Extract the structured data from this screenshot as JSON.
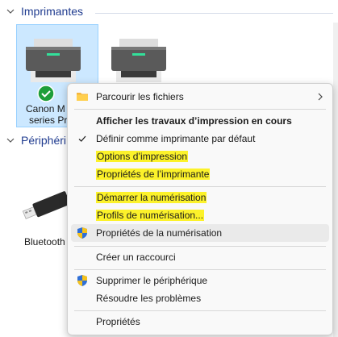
{
  "sections": [
    {
      "title": "Imprimantes"
    },
    {
      "title": "Périphéri"
    }
  ],
  "devices": [
    {
      "label_line1": "Canon M",
      "label_line2": "series Pr"
    },
    {
      "label": "Bluetooth"
    }
  ],
  "menu": {
    "items": [
      {
        "label": "Parcourir les fichiers"
      },
      {
        "label": "Afficher les travaux d’impression en cours"
      },
      {
        "label": "Définir comme imprimante par défaut"
      },
      {
        "label": "Options d’impression"
      },
      {
        "label": "Propriétés de l’imprimante"
      },
      {
        "label": "Démarrer la numérisation"
      },
      {
        "label": "Profils de numérisation..."
      },
      {
        "label": "Propriétés de la numérisation"
      },
      {
        "label": "Créer un raccourci"
      },
      {
        "label": "Supprimer le périphérique"
      },
      {
        "label": "Résoudre les problèmes"
      },
      {
        "label": "Propriétés"
      }
    ]
  },
  "colors": {
    "section_title": "#1f3b8f",
    "highlight": "#fcf22a",
    "selection": "#cce8ff"
  }
}
